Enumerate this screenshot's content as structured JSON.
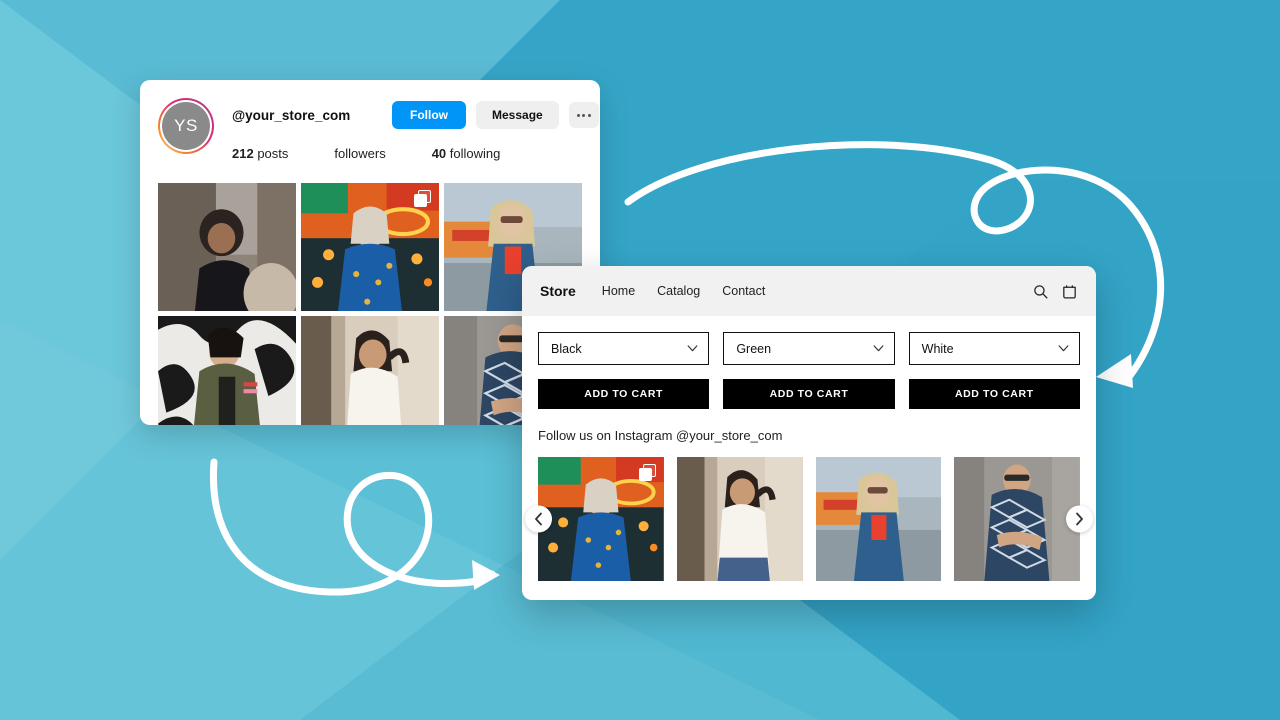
{
  "background": {
    "base_color": "#5BBFD6",
    "band_light_color": "#79CDDE",
    "band_dark_color": "#2FA0C4"
  },
  "decorations": {
    "arrow_color": "#FFFFFF",
    "top_arrow_name": "curved-loop-arrow-top-right",
    "bottom_arrow_name": "curved-loop-arrow-bottom-left"
  },
  "instagram_card": {
    "avatar": {
      "initials": "YS",
      "ring_gradient": "#F58529 -> #DD2A7B -> #8134AF"
    },
    "handle": "@your_store_com",
    "buttons": {
      "follow_label": "Follow",
      "follow_color": "#0095F6",
      "message_label": "Message",
      "more_label": "···"
    },
    "stats": [
      {
        "value": "212",
        "label": "posts"
      },
      {
        "value": "",
        "label": "followers"
      },
      {
        "value": "40",
        "label": "following"
      }
    ],
    "grid": [
      {
        "alt": "woman-curly-hair-black-top",
        "has_multi_icon": false
      },
      {
        "alt": "woman-blue-patterned-shirt-at-fairground",
        "has_multi_icon": true
      },
      {
        "alt": "woman-denim-jacket-red-top-fairground",
        "has_multi_icon": false
      },
      {
        "alt": "woman-green-jacket-graffiti-wall",
        "has_multi_icon": false
      },
      {
        "alt": "woman-white-shirt-smiling-wall",
        "has_multi_icon": false
      },
      {
        "alt": "man-blue-patterned-shirt-sunglasses",
        "has_multi_icon": false
      }
    ]
  },
  "store_card": {
    "title": "Store",
    "nav": [
      "Home",
      "Catalog",
      "Contact"
    ],
    "icons": [
      "search-icon",
      "shopping-bag-icon"
    ],
    "variants": [
      {
        "selected": "Black"
      },
      {
        "selected": "Green"
      },
      {
        "selected": "White"
      }
    ],
    "add_to_cart_labels": [
      "ADD TO CART",
      "ADD TO CART",
      "ADD TO CART"
    ],
    "add_to_cart_color": "#000000",
    "follow_text": "Follow us on Instagram @your_store_com",
    "carousel": {
      "prev_label": "‹",
      "next_label": "›",
      "items": [
        {
          "alt": "woman-blue-patterned-shirt-at-fairground",
          "has_multi_icon": true
        },
        {
          "alt": "woman-white-shirt-smiling-wall",
          "has_multi_icon": false
        },
        {
          "alt": "woman-denim-jacket-red-top-fairground",
          "has_multi_icon": false
        },
        {
          "alt": "man-blue-patterned-shirt-sunglasses",
          "has_multi_icon": false
        }
      ]
    }
  }
}
